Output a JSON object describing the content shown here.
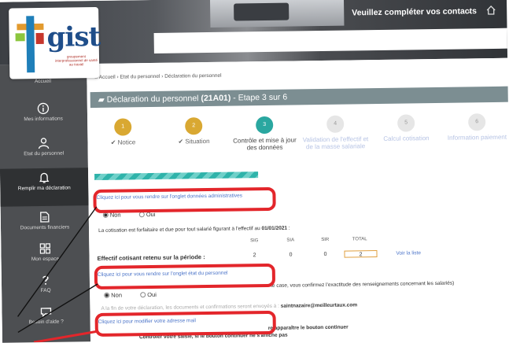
{
  "header": {
    "message": "Veuillez compléter vos contacts",
    "chevron": "⌄",
    "home_icon": "home-icon"
  },
  "logo": {
    "name": "gist",
    "tagline": "groupement interprofessionnel de santé au travail"
  },
  "sidebar": {
    "items": [
      {
        "label": "Accueil",
        "icon": "home-icon"
      },
      {
        "label": "Mes informations",
        "icon": "info-icon"
      },
      {
        "label": "Etat du personnel",
        "icon": "people-icon"
      },
      {
        "label": "Remplir ma déclaration",
        "icon": "bell-icon",
        "active": true
      },
      {
        "label": "Documents financiers",
        "icon": "document-icon"
      },
      {
        "label": "Mon espace",
        "icon": "grid-icon"
      },
      {
        "label": "FAQ",
        "icon": "question-icon"
      },
      {
        "label": "Besoin d'aide ?",
        "icon": "chat-icon"
      }
    ]
  },
  "breadcrumb": {
    "home": "Accueil",
    "sep": "›",
    "level1": "Etat du personnel",
    "level2": "Déclaration du personnel"
  },
  "title": {
    "prefix": "Déclaration du personnel ",
    "code": "(21A01)",
    "suffix": " - Etape 3 sur 6"
  },
  "steps": [
    {
      "num": "1",
      "label": "✔ Notice",
      "state": "done"
    },
    {
      "num": "2",
      "label": "✔ Situation",
      "state": "done"
    },
    {
      "num": "3",
      "label": "Contrôle et mise à jour des données",
      "state": "current"
    },
    {
      "num": "4",
      "label": "Validation de l'effectif et de la masse salariale",
      "state": "todo"
    },
    {
      "num": "5",
      "label": "Calcul cotisation",
      "state": "todo"
    },
    {
      "num": "6",
      "label": "Information paiement",
      "state": "todo"
    }
  ],
  "progress_fraction": 0.4,
  "section1": {
    "link": "Cliquez ici pour vous rendre sur l'onglet données administratives",
    "options": [
      "Non",
      "Oui"
    ],
    "selected": "Non"
  },
  "cotisation": {
    "text_prefix": "La cotisation est forfaitaire et due pour tout salarié figurant à l'effectif au ",
    "date": "01/01/2021",
    "text_suffix": " :",
    "headers": [
      "SIG",
      "SIA",
      "SIR",
      "TOTAL"
    ],
    "row_label": "Effectif cotisant retenu sur la période :",
    "values": [
      "2",
      "0",
      "0",
      "2"
    ],
    "list_link": "Voir la liste"
  },
  "section2": {
    "link": "Cliquez ici pour vous rendre sur l'onglet état du personnel",
    "partial_text": "te case, vous confirmez l'exactitude des renseignements concernant les salariés)",
    "options": [
      "Non",
      "Oui"
    ],
    "selected": "Non",
    "email_prefix": "A la fin de votre déclaration, les documents et confirmations seront envoyés à : ",
    "email": "saintnazaire@meilleurtaux.com"
  },
  "section3": {
    "link": "Cliquez ici pour modifier votre adresse mail",
    "line1": "re apparaître le bouton continuer",
    "line2": "Contrôler votre saisie, si le bouton continuer ne s'affiche pas"
  },
  "colors": {
    "highlight": "#e3262b",
    "teal": "#2aa7a0",
    "gold": "#d9a832",
    "link": "#4a73c8",
    "titlebar": "#7c8e92",
    "sidebar": "#4d4f52"
  }
}
